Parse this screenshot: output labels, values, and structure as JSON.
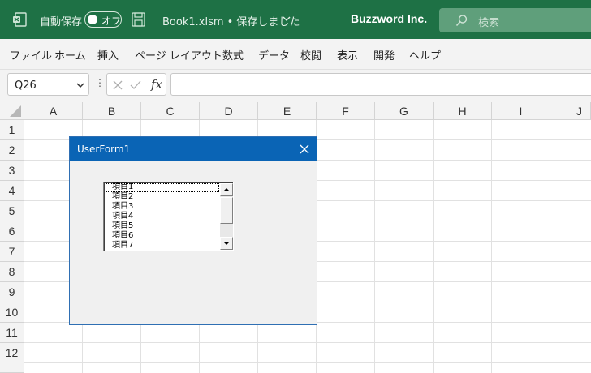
{
  "titlebar": {
    "autosave_label": "自動保存",
    "autosave_state": "オフ",
    "file_name": "Book1.xlsm • 保存しました",
    "company": "Buzzword Inc.",
    "search_placeholder": "検索",
    "bg_color": "#1e7145"
  },
  "menu": [
    {
      "label": "ファイル"
    },
    {
      "label": "ホーム"
    },
    {
      "label": "挿入"
    },
    {
      "label": "ページ レイアウト"
    },
    {
      "label": "数式"
    },
    {
      "label": "データ"
    },
    {
      "label": "校閲"
    },
    {
      "label": "表示"
    },
    {
      "label": "開発"
    },
    {
      "label": "ヘルプ"
    }
  ],
  "formula_bar": {
    "name_box": "Q26",
    "fx_label": "fx",
    "formula": ""
  },
  "grid": {
    "columns": [
      "A",
      "B",
      "C",
      "D",
      "E",
      "F",
      "G",
      "H",
      "I",
      "J"
    ],
    "rows": [
      "1",
      "2",
      "3",
      "4",
      "5",
      "6",
      "7",
      "8",
      "9",
      "10",
      "11",
      "12"
    ]
  },
  "userform": {
    "title": "UserForm1",
    "listbox_items": [
      "項目1",
      "項目2",
      "項目3",
      "項目4",
      "項目5",
      "項目6",
      "項目7"
    ],
    "accent_color": "#0a64b5"
  }
}
